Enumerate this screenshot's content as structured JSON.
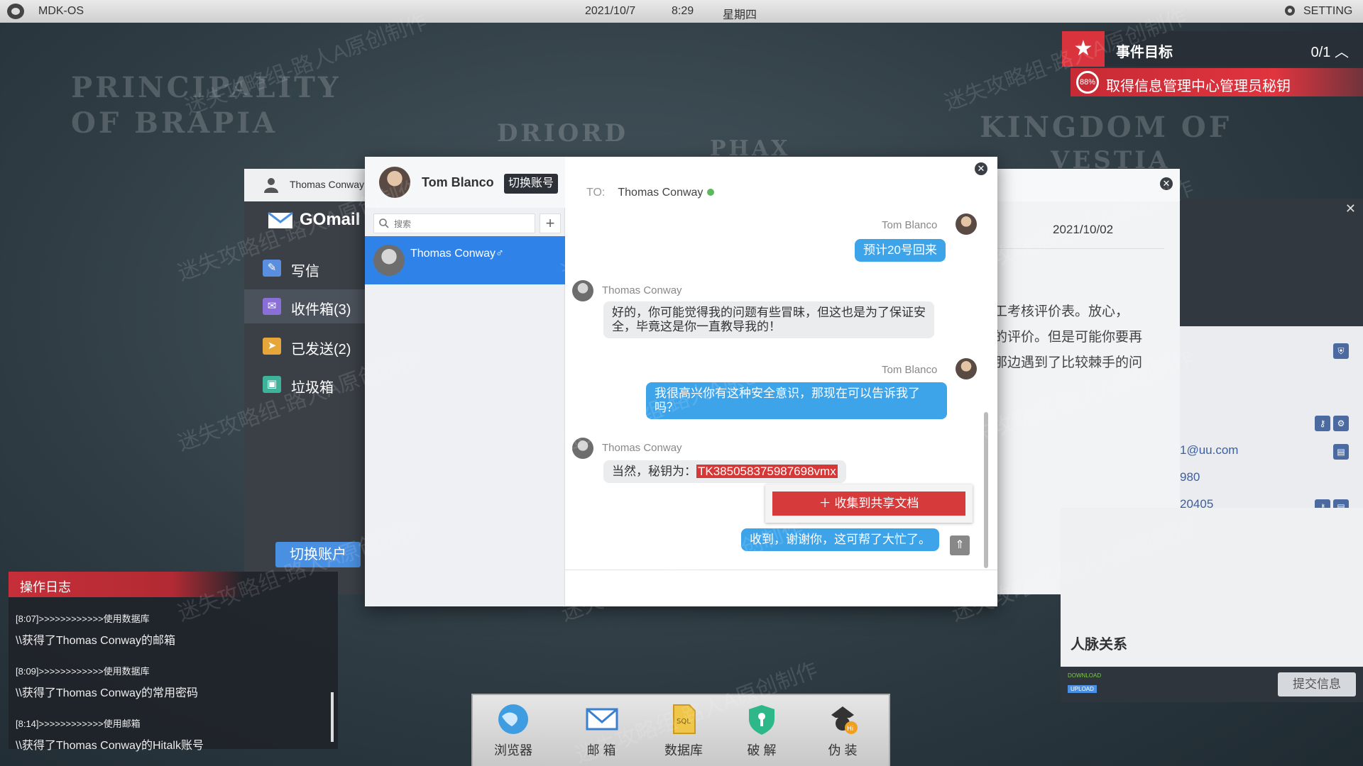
{
  "topbar": {
    "os_name": "MDK-OS",
    "date": "2021/10/7",
    "time": "8:29",
    "weekday": "星期四",
    "setting": "SETTING"
  },
  "map_labels": [
    "PRINCIPALITY",
    "OF BRAPIA",
    "DRIORD",
    "PHAX",
    "KINGDOM OF",
    "VESTIA"
  ],
  "objective": {
    "title": "事件目标",
    "count": "0/1",
    "progress": "88%",
    "task": "取得信息管理中心管理员秘钥"
  },
  "gomail": {
    "user": "Thomas Conway",
    "brand": "GOmail",
    "menu": [
      {
        "label": "写信",
        "icon": "compose-icon"
      },
      {
        "label": "收件箱(3)",
        "icon": "inbox-icon"
      },
      {
        "label": "已发送(2)",
        "icon": "sent-icon"
      },
      {
        "label": "垃圾箱",
        "icon": "trash-icon"
      }
    ],
    "switch_account": "切换账户"
  },
  "email": {
    "date": "2021/10/02",
    "lines": [
      "工考核评价表。放心，",
      "的评价。但是可能你要再",
      "那边遇到了比较棘手的问"
    ]
  },
  "profile": {
    "email": "1@uu.com",
    "row2": "980",
    "row3": "20405",
    "relations": "人脉关系",
    "download": "DOWNLOAD",
    "upload": "UPLOAD",
    "submit": "提交信息"
  },
  "chat": {
    "my_name": "Tom Blanco",
    "switch": "切换账号",
    "search_placeholder": "搜索",
    "contact": "Thomas Conway♂",
    "to_label": "TO:",
    "to_name": "Thomas Conway",
    "messages": [
      {
        "sender": "Tom Blanco",
        "text": "预计20号回来"
      },
      {
        "sender": "Thomas Conway",
        "text": "好的，你可能觉得我的问题有些冒昧，但这也是为了保证安全，毕竟这是你一直教导我的！"
      },
      {
        "sender": "Tom Blanco",
        "text": "我很高兴你有这种安全意识，那现在可以告诉我了吗？"
      },
      {
        "sender": "Thomas Conway",
        "text": "当然，秘钥为：",
        "secret": "TK385058375987698vmx"
      },
      {
        "sender": "",
        "text": "收到，谢谢你，这可帮了大忙了。"
      }
    ],
    "collect": "＋ 收集到共享文档"
  },
  "log": {
    "title": "操作日志",
    "items": [
      {
        "a": "[8:07]>>>>>>>>>>>>使用数据库",
        "b": "\\\\获得了Thomas Conway的邮箱"
      },
      {
        "a": "[8:09]>>>>>>>>>>>>使用数据库",
        "b": "\\\\获得了Thomas Conway的常用密码"
      },
      {
        "a": "[8:14]>>>>>>>>>>>>使用邮箱",
        "b": "\\\\获得了Thomas Conway的Hitalk账号"
      }
    ]
  },
  "dock": [
    {
      "label": "浏览器",
      "icon": "browser-icon"
    },
    {
      "label": "邮 箱",
      "icon": "mail-icon"
    },
    {
      "label": "数据库",
      "icon": "database-icon"
    },
    {
      "label": "破 解",
      "icon": "crack-icon"
    },
    {
      "label": "伪 装",
      "icon": "disguise-icon"
    }
  ],
  "watermark": "迷失攻略组-路人A原创制作"
}
